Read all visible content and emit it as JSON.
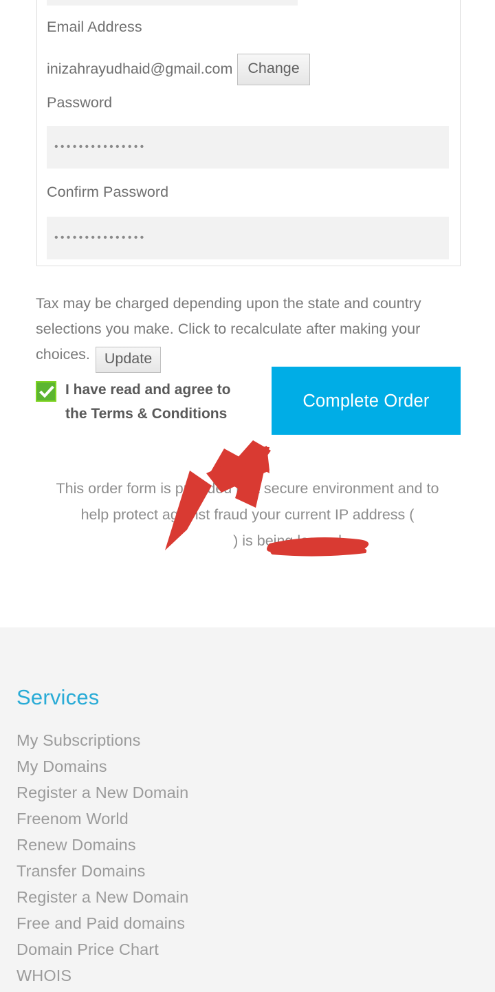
{
  "form": {
    "email_label": "Email Address",
    "email_value": "inizahrayudhaid@gmail.com",
    "change_button": "Change",
    "password_label": "Password",
    "password_masked": "•••••••••••••••",
    "confirm_password_label": "Confirm Password",
    "confirm_password_masked": "•••••••••••••••"
  },
  "tax": {
    "notice_part1": "Tax may be charged depending upon the state and country selections you make. Click to recalculate after making your choices.",
    "update_button": "Update"
  },
  "terms": {
    "checkbox_checked": true,
    "label_prefix": "I have read and agree to the ",
    "label_link": "Terms & Conditions"
  },
  "actions": {
    "complete_order": "Complete Order",
    "complete_order_color": "#00ade6"
  },
  "security": {
    "notice_before_ip": "This order form is provided in a secure environment and to help protect against fraud your current IP address (",
    "ip_address_redacted": "",
    "notice_after_ip": ") is being logged."
  },
  "annotation": {
    "arrow_color": "#d93a32",
    "redaction_color": "#d93a32"
  },
  "footer": {
    "heading": "Services",
    "heading_color": "#29abd6",
    "links": [
      "My Subscriptions",
      "My Domains",
      "Register a New Domain",
      "Freenom World",
      "Renew Domains",
      "Transfer Domains",
      "Register a New Domain",
      "Free and Paid domains",
      "Domain Price Chart",
      "WHOIS"
    ]
  }
}
